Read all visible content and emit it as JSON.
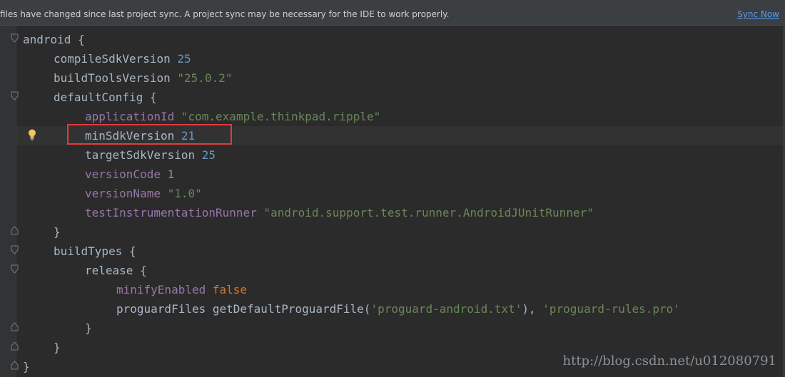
{
  "banner": {
    "message": "files have changed since last project sync. A project sync may be necessary for the IDE to work properly.",
    "action": "Sync Now"
  },
  "code": {
    "l1": {
      "name": "android",
      "brace": " {"
    },
    "l2": {
      "key": "compileSdkVersion",
      "value": "25"
    },
    "l3": {
      "key": "buildToolsVersion",
      "value": "\"25.0.2\""
    },
    "l4": {
      "name": "defaultConfig",
      "brace": " {"
    },
    "l5": {
      "key": "applicationId",
      "value": "\"com.example.thinkpad.ripple\""
    },
    "l6": {
      "key": "minSdkVersion",
      "value": "21"
    },
    "l7": {
      "key": "targetSdkVersion",
      "value": "25"
    },
    "l8": {
      "key": "versionCode",
      "value": "1"
    },
    "l9": {
      "key": "versionName",
      "value": "\"1.0\""
    },
    "l10": {
      "key": "testInstrumentationRunner",
      "value": "\"android.support.test.runner.AndroidJUnitRunner\""
    },
    "l11": {
      "brace": "}"
    },
    "l12": {
      "name": "buildTypes",
      "brace": " {"
    },
    "l13": {
      "name": "release",
      "brace": " {"
    },
    "l14": {
      "key": "minifyEnabled",
      "value": "false"
    },
    "l15": {
      "key": "proguardFiles",
      "call": "getDefaultProguardFile",
      "open": "(",
      "arg1": "'proguard-android.txt'",
      "close": "),",
      "arg2": "'proguard-rules.pro'"
    },
    "l16": {
      "brace": "}"
    },
    "l17": {
      "brace": "}"
    },
    "l18": {
      "brace": "}"
    }
  },
  "watermark": "http://blog.csdn.net/u012080791",
  "colors": {
    "background": "#2b2b2b",
    "plain": "#a9b7c6",
    "number": "#6897bb",
    "string": "#6a8759",
    "property": "#9876aa",
    "keyword": "#cc7832",
    "highlight_box": "#e23b3b",
    "link": "#589df6"
  },
  "icons": {
    "gutter_fold": "fold-marker-icon",
    "intention": "lightbulb-icon"
  }
}
